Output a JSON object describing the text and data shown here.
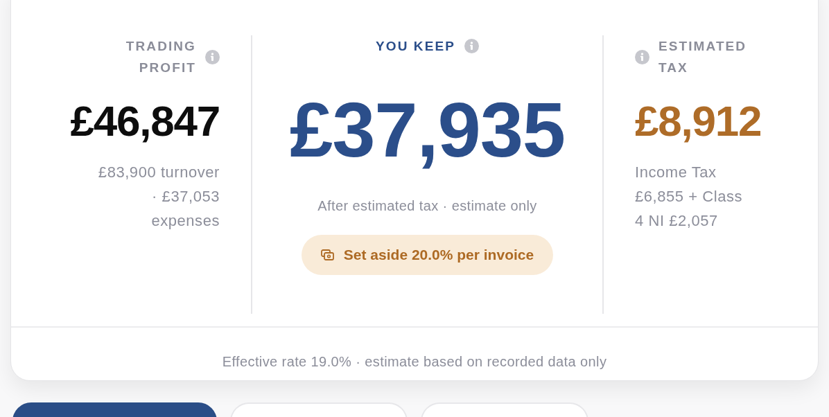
{
  "summary": {
    "columns": [
      {
        "kind": "profit",
        "label": "TRADING PROFIT",
        "value": "£46,847",
        "detail": "£83,900 turnover · £37,053 expenses"
      },
      {
        "kind": "keep",
        "label": "YOU KEEP",
        "value": "£37,935",
        "detail": "After estimated tax · estimate only",
        "badge": "Set aside 20.0% per invoice"
      },
      {
        "kind": "tax",
        "label": "ESTIMATED TAX",
        "value": "£8,912",
        "detail": "Income Tax £6,855 + Class 4 NI £2,057"
      }
    ],
    "footer": "Effective rate 19.0% · estimate based on recorded data only"
  },
  "tabs": [
    {
      "selected": true
    },
    {
      "selected": false
    },
    {
      "selected": false
    }
  ]
}
